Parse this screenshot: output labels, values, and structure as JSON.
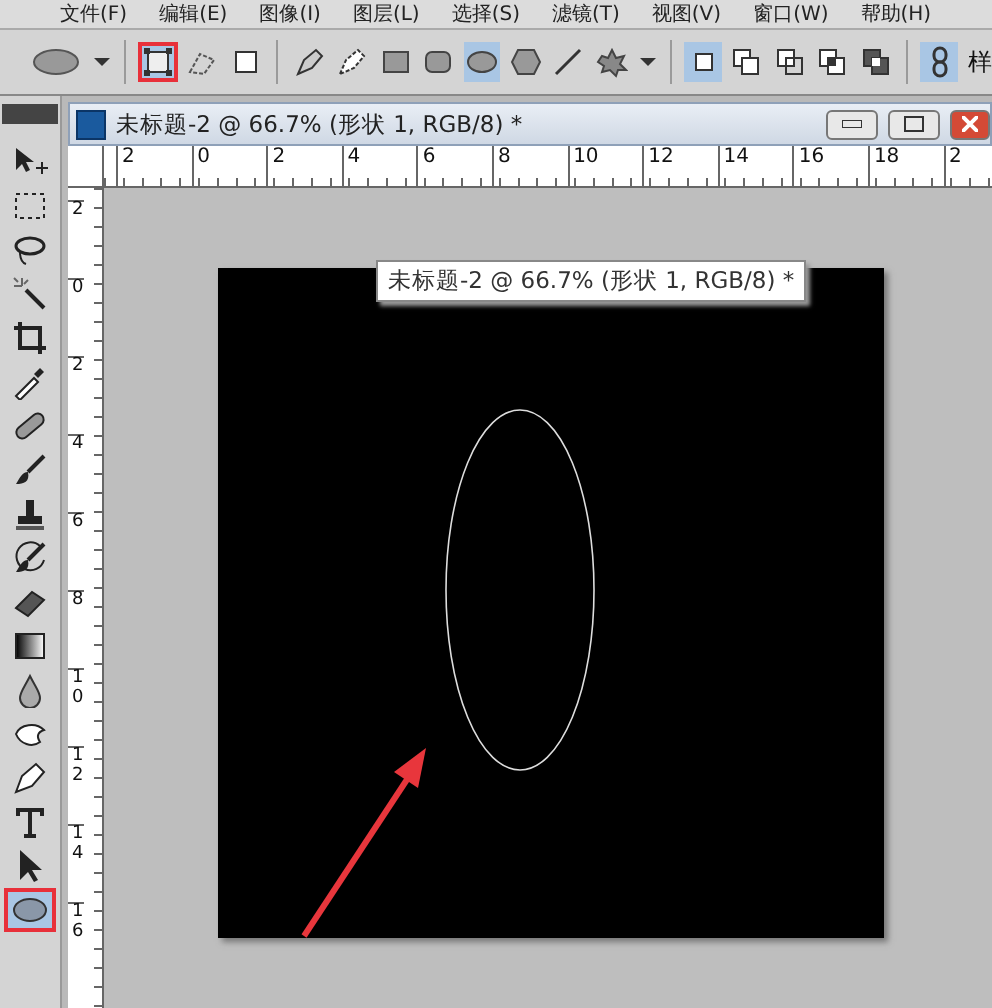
{
  "menu_bar": {
    "items": [
      "文件(F)",
      "编辑(E)",
      "图像(I)",
      "图层(L)",
      "选择(S)",
      "滤镜(T)",
      "视图(V)",
      "窗口(W)",
      "帮助(H)"
    ]
  },
  "options_bar": {
    "tools": [
      {
        "kind": "ellipse-preset",
        "selected": false,
        "highlighted": false
      },
      {
        "kind": "caret",
        "selected": false,
        "highlighted": false
      },
      {
        "kind": "divider"
      },
      {
        "kind": "shape-layers",
        "selected": true,
        "highlighted": true
      },
      {
        "kind": "paths",
        "selected": false,
        "highlighted": false
      },
      {
        "kind": "fill-pixels",
        "selected": false,
        "highlighted": false
      },
      {
        "kind": "divider"
      },
      {
        "kind": "pen",
        "selected": false,
        "highlighted": false
      },
      {
        "kind": "freeform-pen",
        "selected": false,
        "highlighted": false
      },
      {
        "kind": "rect",
        "selected": false,
        "highlighted": false
      },
      {
        "kind": "rounded-rect",
        "selected": false,
        "highlighted": false
      },
      {
        "kind": "ellipse",
        "selected": true,
        "highlighted": false
      },
      {
        "kind": "polygon",
        "selected": false,
        "highlighted": false
      },
      {
        "kind": "line",
        "selected": false,
        "highlighted": false
      },
      {
        "kind": "custom-shape",
        "selected": false,
        "highlighted": false
      },
      {
        "kind": "caret",
        "selected": false,
        "highlighted": false
      },
      {
        "kind": "divider"
      },
      {
        "kind": "mode-new",
        "selected": true,
        "highlighted": false
      },
      {
        "kind": "mode-add",
        "selected": false,
        "highlighted": false
      },
      {
        "kind": "mode-subtract",
        "selected": false,
        "highlighted": false
      },
      {
        "kind": "mode-intersect",
        "selected": false,
        "highlighted": false
      },
      {
        "kind": "mode-exclude",
        "selected": false,
        "highlighted": false
      },
      {
        "kind": "divider"
      },
      {
        "kind": "link",
        "selected": true,
        "highlighted": false
      }
    ],
    "style_label": "样"
  },
  "toolbox": {
    "tools": [
      {
        "kind": "move",
        "selected": false,
        "highlighted": false
      },
      {
        "kind": "marquee",
        "selected": false,
        "highlighted": false
      },
      {
        "kind": "lasso",
        "selected": false,
        "highlighted": false
      },
      {
        "kind": "wand",
        "selected": false,
        "highlighted": false
      },
      {
        "kind": "crop",
        "selected": false,
        "highlighted": false
      },
      {
        "kind": "eyedropper",
        "selected": false,
        "highlighted": false
      },
      {
        "kind": "healing",
        "selected": false,
        "highlighted": false
      },
      {
        "kind": "brush",
        "selected": false,
        "highlighted": false
      },
      {
        "kind": "stamp",
        "selected": false,
        "highlighted": false
      },
      {
        "kind": "history",
        "selected": false,
        "highlighted": false
      },
      {
        "kind": "eraser",
        "selected": false,
        "highlighted": false
      },
      {
        "kind": "gradient",
        "selected": false,
        "highlighted": false
      },
      {
        "kind": "blur",
        "selected": false,
        "highlighted": false
      },
      {
        "kind": "dodge",
        "selected": false,
        "highlighted": false
      },
      {
        "kind": "pen",
        "selected": false,
        "highlighted": false
      },
      {
        "kind": "type",
        "selected": false,
        "highlighted": false
      },
      {
        "kind": "path-select",
        "selected": false,
        "highlighted": false
      },
      {
        "kind": "ellipse",
        "selected": true,
        "highlighted": true
      }
    ]
  },
  "document": {
    "title": "未标题-2 @ 66.7% (形状 1, RGB/8) *",
    "tooltip": "未标题-2 @ 66.7% (形状 1, RGB/8) *",
    "top_ruler": [
      "2",
      "0",
      "2",
      "4",
      "6",
      "8",
      "10",
      "12",
      "14",
      "16",
      "18",
      "2"
    ],
    "left_ruler": [
      "2",
      "0",
      "2",
      "4",
      "6",
      "8",
      "10",
      "12",
      "14",
      "16"
    ]
  }
}
